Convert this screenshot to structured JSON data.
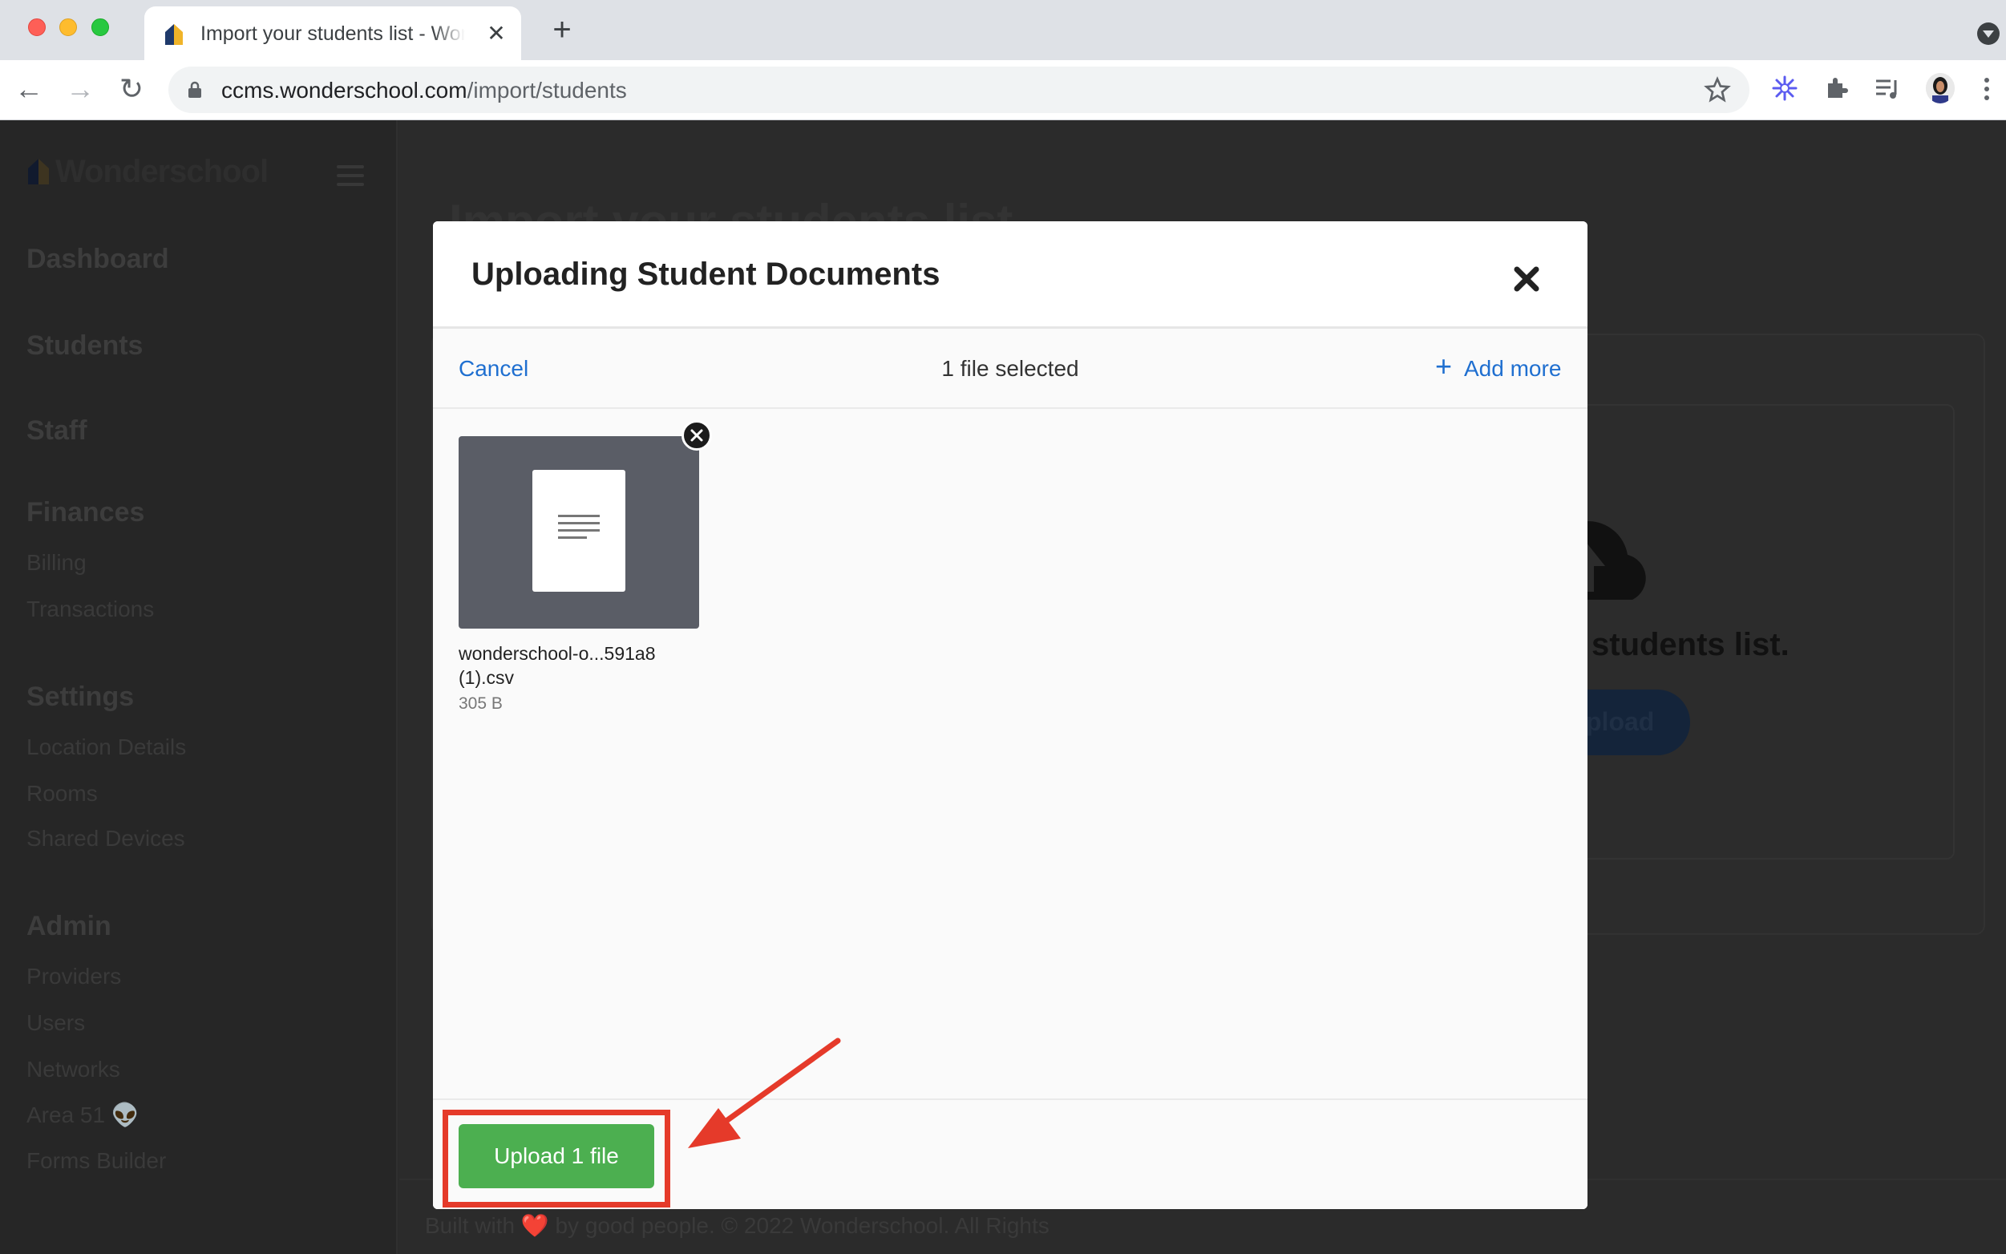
{
  "browser": {
    "tab_title": "Import your students list - Wonderschool",
    "url_domain": "ccms.wonderschool.com",
    "url_path": "/import/students"
  },
  "sidebar": {
    "logo_text": "Wonderschool",
    "sections": [
      {
        "label": "Dashboard"
      },
      {
        "label": "Students"
      },
      {
        "label": "Staff"
      },
      {
        "label": "Finances",
        "items": [
          "Billing",
          "Transactions"
        ]
      },
      {
        "label": "Settings",
        "items": [
          "Location Details",
          "Rooms",
          "Shared Devices"
        ]
      },
      {
        "label": "Admin",
        "items": [
          "Providers",
          "Users",
          "Networks",
          "Area 51 👽",
          "Forms Builder"
        ]
      }
    ]
  },
  "main": {
    "page_title": "Import your students list",
    "tagline": "students list.",
    "upload_label": "pload",
    "footer": "Built with ❤️ by good people. © 2022 Wonderschool. All Rights"
  },
  "modal": {
    "title": "Uploading Student Documents",
    "cancel": "Cancel",
    "status": "1 file selected",
    "add_more": "Add more",
    "file": {
      "name": "wonderschool-o...591a8 (1).csv",
      "size": "305 B"
    },
    "upload_button": "Upload 1 file"
  },
  "colors": {
    "accent_link": "#1f6fd0",
    "upload_green": "#4caf50",
    "annotation_red": "#e53a2a"
  }
}
